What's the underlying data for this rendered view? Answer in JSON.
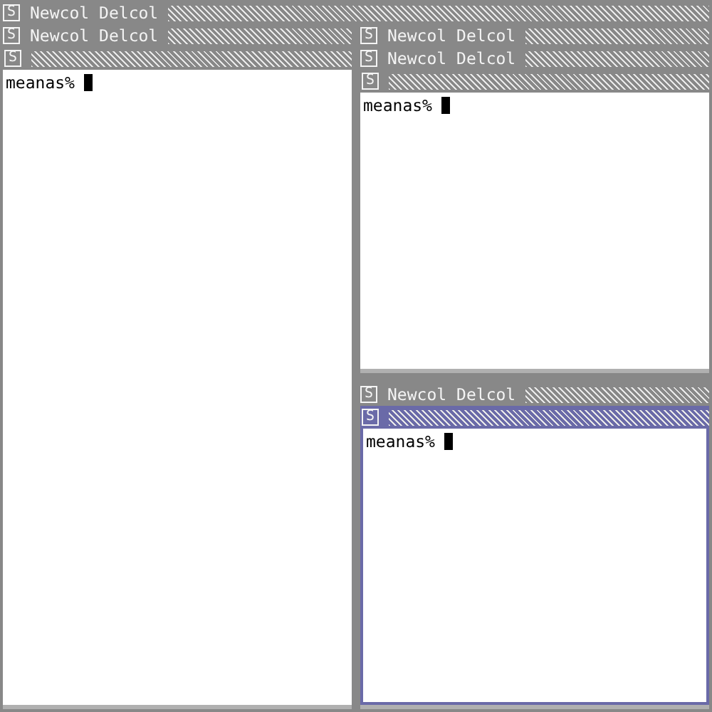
{
  "root": {
    "box": "S",
    "commands": [
      "Newcol",
      "Delcol"
    ],
    "children": [
      {
        "kind": "column",
        "box": "S",
        "commands": [
          "Newcol",
          "Delcol"
        ],
        "children": [
          {
            "kind": "window",
            "box": "S",
            "selected": false,
            "text": "meanas%"
          }
        ]
      },
      {
        "kind": "column",
        "box": "S",
        "commands": [
          "Newcol",
          "Delcol"
        ],
        "children": [
          {
            "kind": "column",
            "box": "S",
            "commands": [
              "Newcol",
              "Delcol"
            ],
            "children": [
              {
                "kind": "window",
                "box": "S",
                "selected": false,
                "text": "meanas%"
              }
            ]
          },
          {
            "kind": "column",
            "box": "S",
            "commands": [
              "Newcol",
              "Delcol"
            ],
            "children": [
              {
                "kind": "window",
                "box": "S",
                "selected": true,
                "text": "meanas%"
              }
            ]
          }
        ]
      }
    ]
  }
}
